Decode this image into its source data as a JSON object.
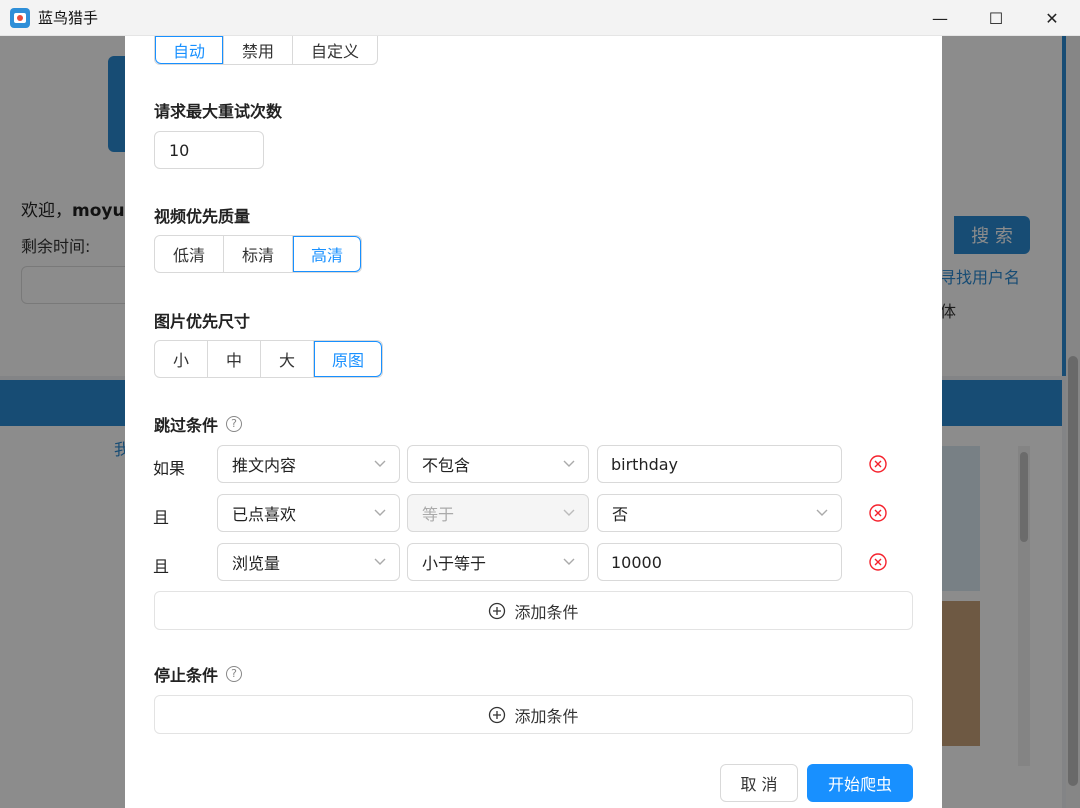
{
  "window": {
    "title": "蓝鸟猎手",
    "minimize_glyph": "—",
    "maximize_glyph": "☐",
    "close_glyph": "✕"
  },
  "background": {
    "welcome_prefix": "欢迎，",
    "welcome_user": "moyus",
    "remaining_label": "剩余时间:",
    "search_button": "搜 索",
    "find_username_link": "寻找用户名",
    "text_fragment_1": "体",
    "text_fragment_2": "我"
  },
  "modal": {
    "proxy_mode": {
      "options": [
        "自动",
        "禁用",
        "自定义"
      ],
      "selected": "自动"
    },
    "max_retries": {
      "label": "请求最大重试次数",
      "value": "10"
    },
    "video_quality": {
      "label": "视频优先质量",
      "options": [
        "低清",
        "标清",
        "高清"
      ],
      "selected": "高清"
    },
    "image_size": {
      "label": "图片优先尺寸",
      "options": [
        "小",
        "中",
        "大",
        "原图"
      ],
      "selected": "原图"
    },
    "skip_conditions": {
      "label": "跳过条件",
      "help_glyph": "?",
      "rows": [
        {
          "prefix": "如果",
          "field": "推文内容",
          "operator": "不包含",
          "value": "birthday",
          "value_is_select": false,
          "operator_disabled": false
        },
        {
          "prefix": "且",
          "field": "已点喜欢",
          "operator": "等于",
          "value": "否",
          "value_is_select": true,
          "operator_disabled": true
        },
        {
          "prefix": "且",
          "field": "浏览量",
          "operator": "小于等于",
          "value": "10000",
          "value_is_select": false,
          "operator_disabled": false
        }
      ],
      "add_label": "添加条件"
    },
    "stop_conditions": {
      "label": "停止条件",
      "help_glyph": "?",
      "add_label": "添加条件"
    },
    "footer": {
      "cancel_label": "取 消",
      "start_label": "开始爬虫"
    }
  },
  "colors": {
    "accent": "#1890ff",
    "danger": "#f5222d",
    "brand_blue": "#2a8ad4"
  }
}
